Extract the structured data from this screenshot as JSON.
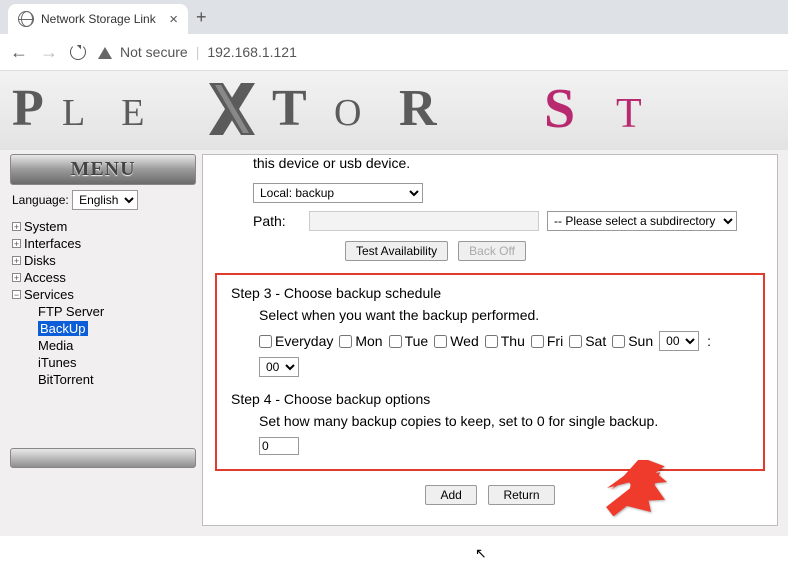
{
  "browser": {
    "tab_title": "Network Storage Link",
    "not_secure": "Not secure",
    "url": "192.168.1.121"
  },
  "brand": {
    "text": "PLEXTOR ST"
  },
  "sidebar": {
    "menu_title": "MENU",
    "language_label": "Language:",
    "language_value": "English",
    "items": [
      {
        "label": "System",
        "exp": "+"
      },
      {
        "label": "Interfaces",
        "exp": "+"
      },
      {
        "label": "Disks",
        "exp": "+"
      },
      {
        "label": "Access",
        "exp": "+"
      },
      {
        "label": "Services",
        "exp": "−"
      }
    ],
    "children": [
      {
        "label": "FTP Server"
      },
      {
        "label": "BackUp"
      },
      {
        "label": "Media"
      },
      {
        "label": "iTunes"
      },
      {
        "label": "BitTorrent"
      }
    ]
  },
  "main": {
    "pretext": "this device or usb device.",
    "source_value": "Local: backup",
    "path_label": "Path:",
    "path_value": "",
    "subdir_value": "-- Please select a subdirectory --",
    "test_btn": "Test Availability",
    "backoff_btn": "Back Off",
    "step3_title": "Step 3 - Choose backup schedule",
    "step3_sub": "Select when you want the backup performed.",
    "days": [
      "Everyday",
      "Mon",
      "Tue",
      "Wed",
      "Thu",
      "Fri",
      "Sat",
      "Sun"
    ],
    "hour": "00",
    "minute": "00",
    "step4_title": "Step 4 - Choose backup options",
    "step4_sub": "Set how many backup copies to keep, set to 0 for single backup.",
    "copies_value": "0",
    "add_btn": "Add",
    "return_btn": "Return"
  }
}
